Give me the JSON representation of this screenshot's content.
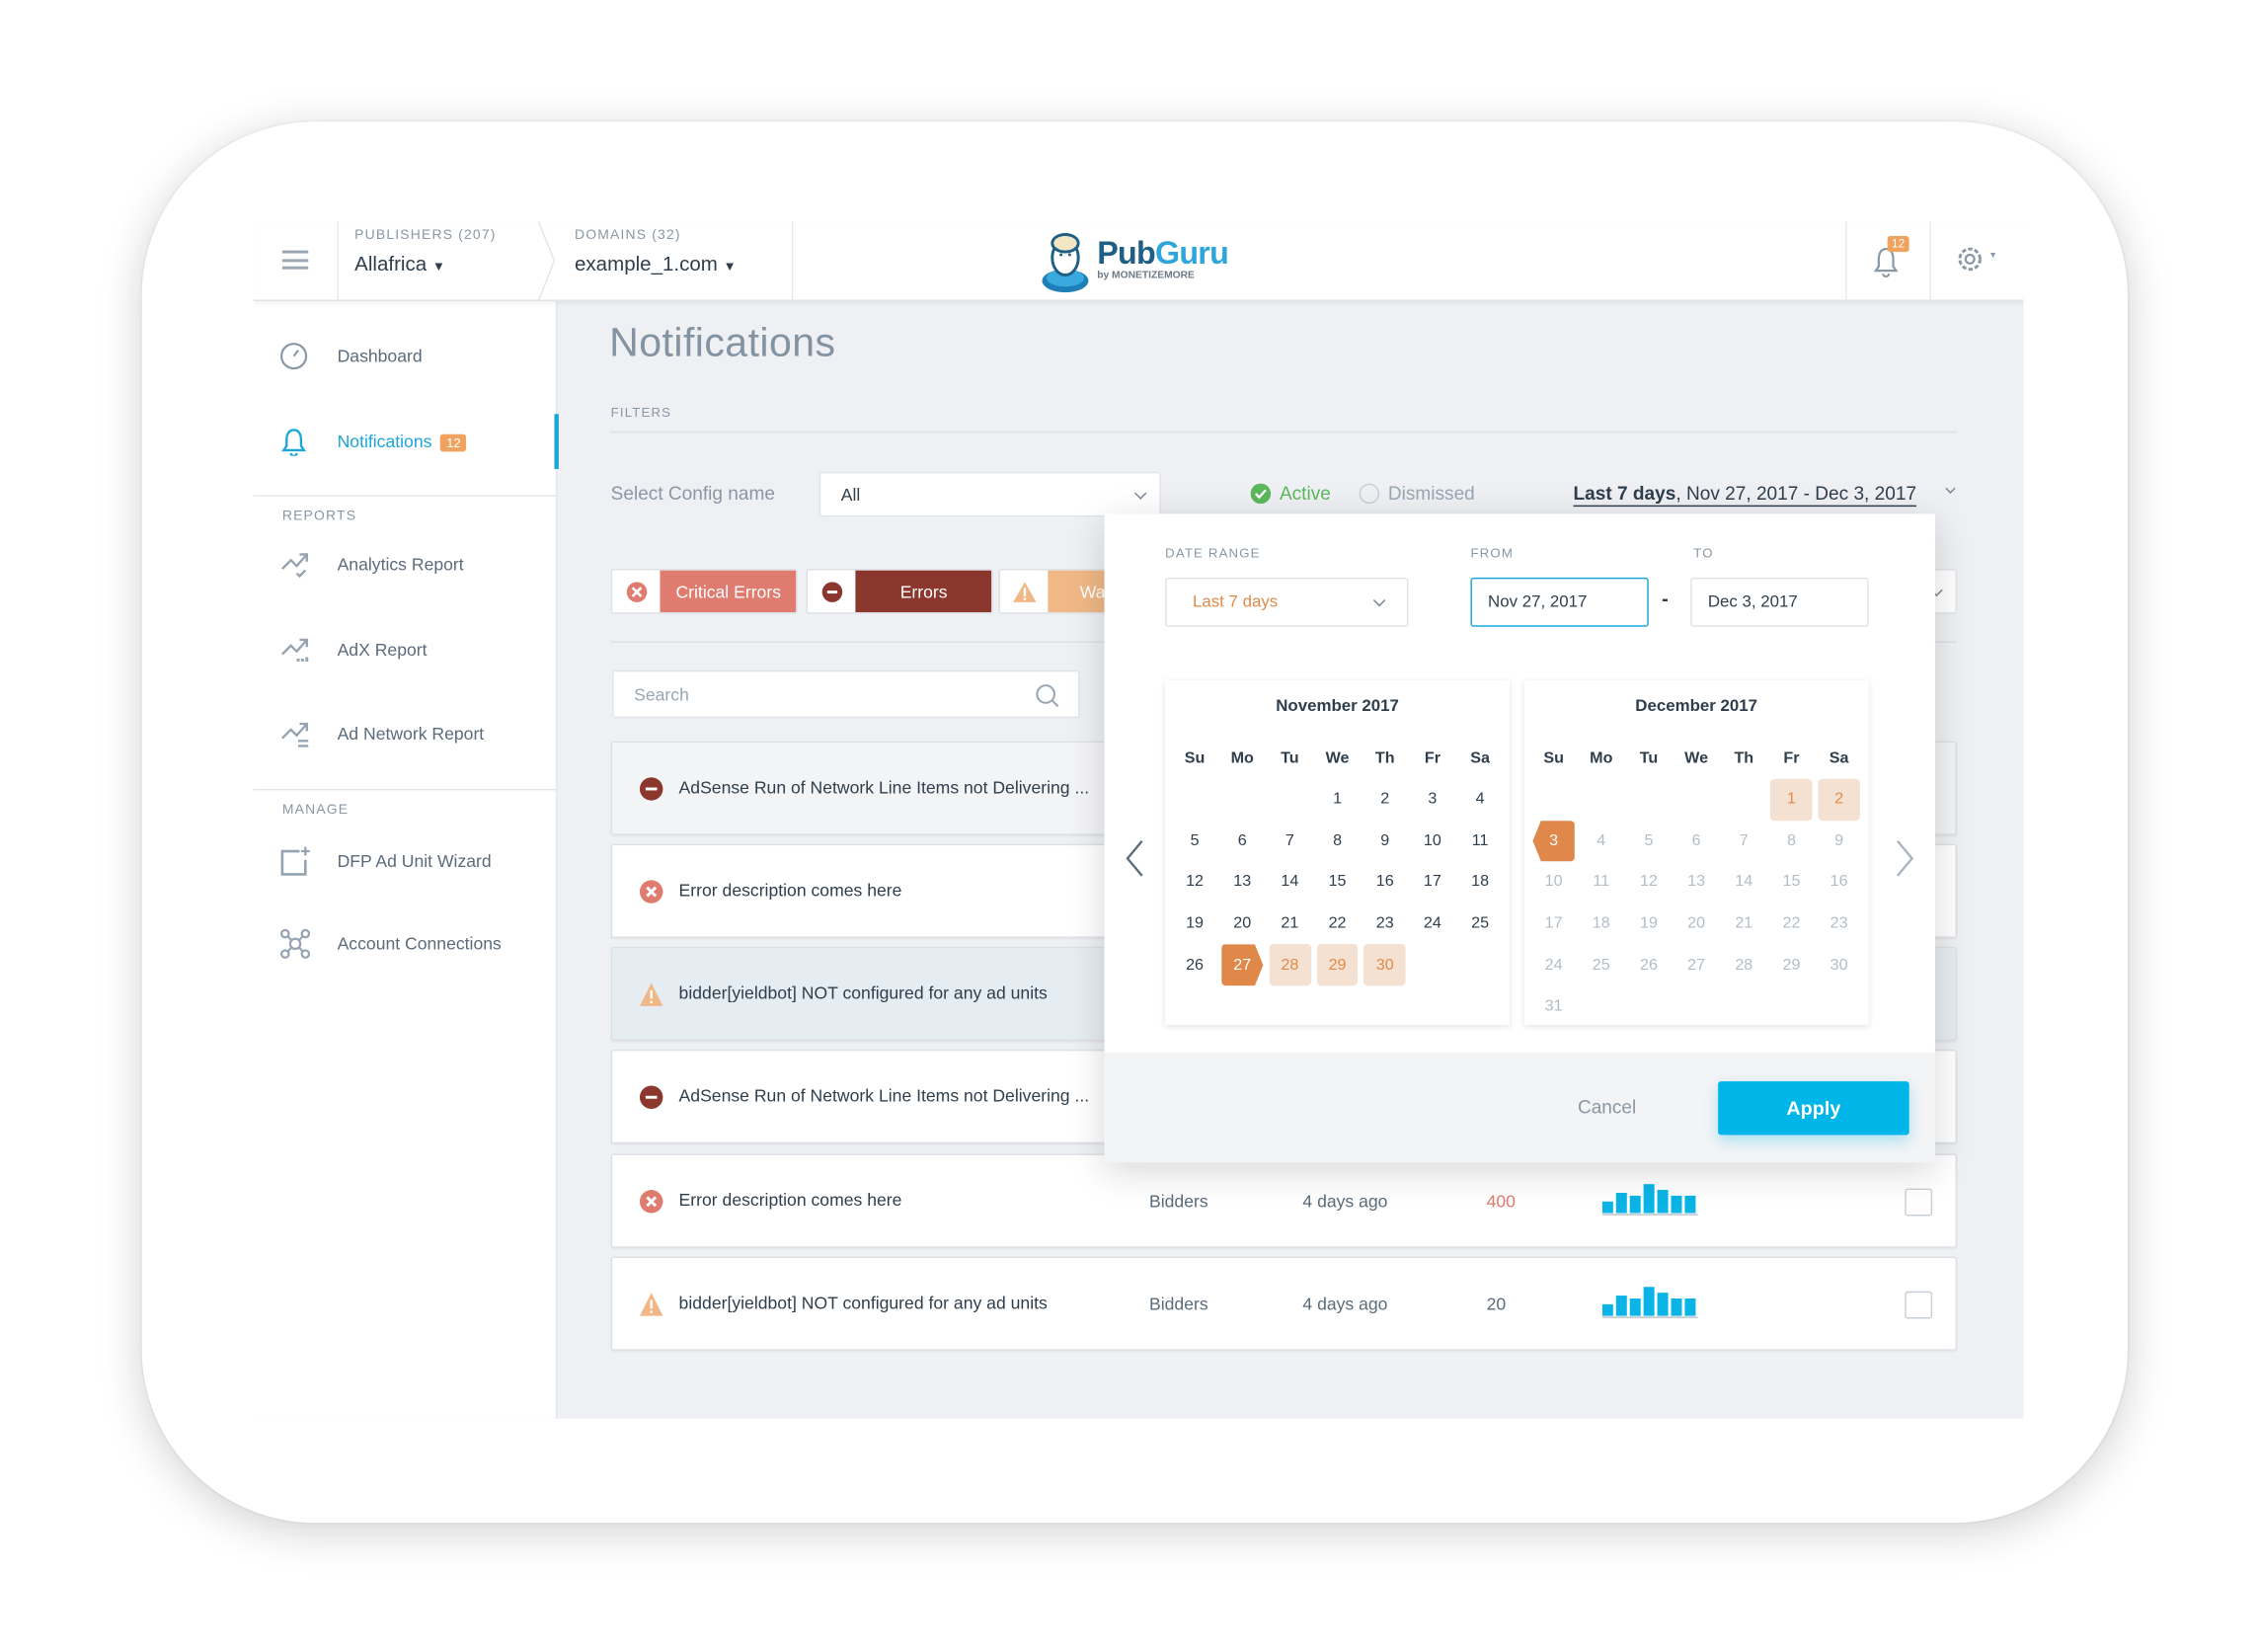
{
  "header": {
    "publishers_label": "PUBLISHERS (207)",
    "publisher_value": "Allafrica",
    "domains_label": "DOMAINS (32)",
    "domain_value": "example_1.com",
    "logo_text_a": "Pub",
    "logo_text_b": "Guru",
    "logo_sub": "by MONETIZEMORE",
    "notification_count": "12"
  },
  "sidebar": {
    "items": [
      {
        "label": "Dashboard",
        "icon": "gauge-icon"
      },
      {
        "label": "Notifications",
        "icon": "bell-icon",
        "badge": "12",
        "active": true
      }
    ],
    "reports_heading": "REPORTS",
    "reports": [
      {
        "label": "Analytics Report",
        "icon": "trend-check-icon"
      },
      {
        "label": "AdX Report",
        "icon": "trend-dots-icon"
      },
      {
        "label": "Ad Network Report",
        "icon": "trend-list-icon"
      }
    ],
    "manage_heading": "MANAGE",
    "manage": [
      {
        "label": "DFP Ad Unit Wizard",
        "icon": "add-square-icon"
      },
      {
        "label": "Account Connections",
        "icon": "network-icon"
      }
    ]
  },
  "main": {
    "title": "Notifications",
    "filters_label": "FILTERS",
    "config_label": "Select Config name",
    "config_value": "All",
    "status_active": "Active",
    "status_dismissed": "Dismissed",
    "date_range_bold": "Last 7 days",
    "date_range_rest": ", Nov 27, 2017 - Dec 3, 2017",
    "chips": [
      {
        "label": "Critical Errors",
        "color": "#df7b6f"
      },
      {
        "label": "Errors",
        "color": "#8b372e"
      },
      {
        "label": "Warnings",
        "color": "#f0b887"
      }
    ],
    "search_placeholder": "Search",
    "rows": [
      {
        "type": "error",
        "text": "AdSense Run of Network Line Items not Delivering ..."
      },
      {
        "type": "critical",
        "text": "Error description comes here"
      },
      {
        "type": "warning",
        "text": "bidder[yieldbot] NOT configured for any ad units"
      },
      {
        "type": "error",
        "text": "AdSense Run of Network Line Items not Delivering ..."
      },
      {
        "type": "critical",
        "text": "Error description comes here",
        "category": "Bidders",
        "time": "4 days ago",
        "count": "400",
        "spark": [
          2,
          3.5,
          3,
          5,
          4,
          3,
          3
        ]
      },
      {
        "type": "warning",
        "text": "bidder[yieldbot] NOT configured for any ad units",
        "category": "Bidders",
        "time": "4 days ago",
        "count": "20",
        "spark": [
          2,
          3.5,
          3,
          5,
          4,
          3,
          3
        ]
      }
    ]
  },
  "datepicker": {
    "range_label": "DATE RANGE",
    "range_value": "Last 7 days",
    "from_label": "FROM",
    "from_value": "Nov 27, 2017",
    "to_label": "TO",
    "to_value": "Dec 3, 2017",
    "separator": "-",
    "weekdays": [
      "Su",
      "Mo",
      "Tu",
      "We",
      "Th",
      "Fr",
      "Sa"
    ],
    "months": [
      {
        "title": "November 2017",
        "first_weekday": 3,
        "days": 30,
        "start": 27,
        "range": [
          28,
          29,
          30
        ],
        "end": null,
        "muted_after": null
      },
      {
        "title": "December 2017",
        "first_weekday": 5,
        "days": 31,
        "start": null,
        "range": [
          1,
          2
        ],
        "end": 3,
        "muted_after": 3
      }
    ],
    "cancel_label": "Cancel",
    "apply_label": "Apply"
  },
  "colors": {
    "accent": "#1aa7d8",
    "apply": "#00b5e8",
    "range_orange": "#e0874a",
    "active_green": "#5cb85c"
  }
}
